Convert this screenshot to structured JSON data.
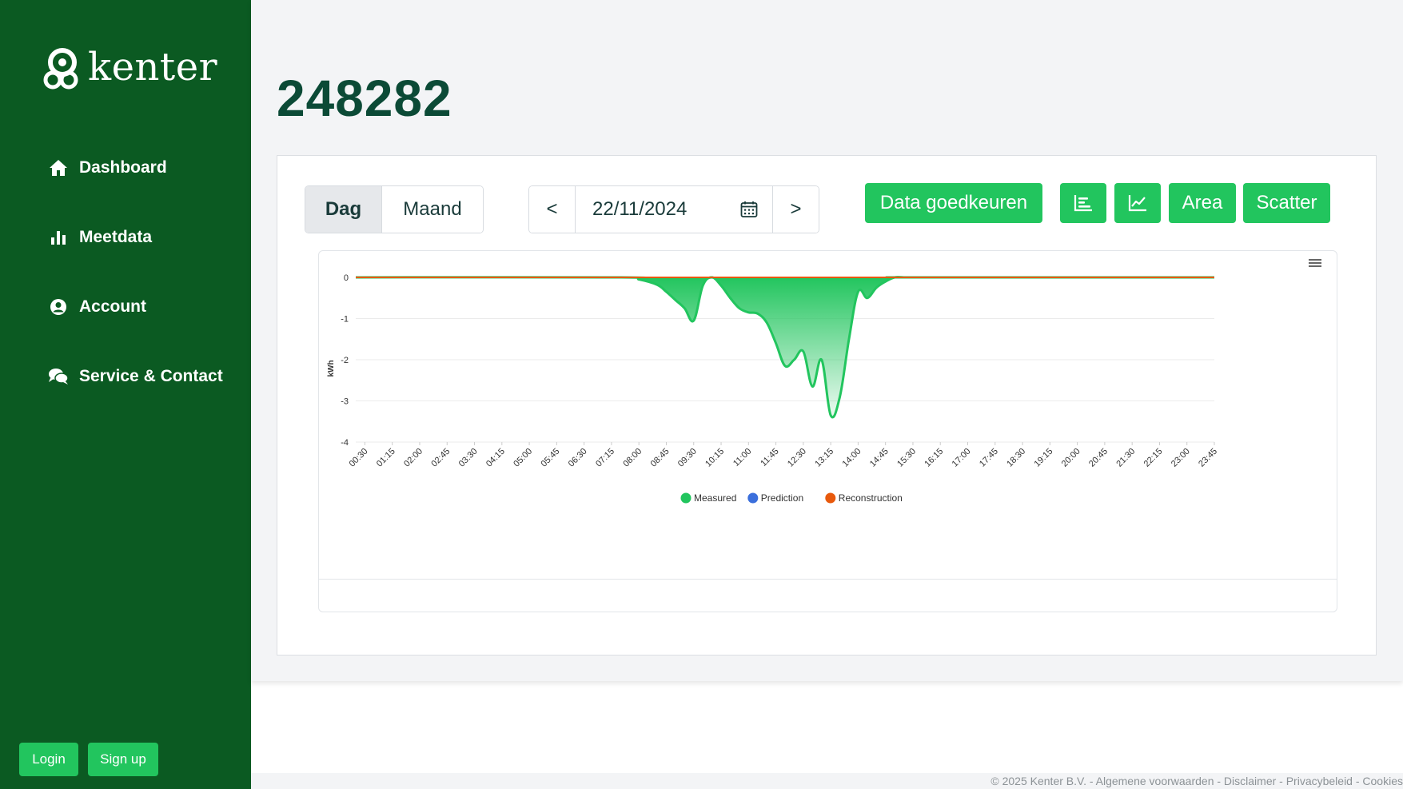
{
  "sidebar": {
    "logo_text": "kenter",
    "nav": [
      {
        "label": "Dashboard",
        "icon": "home-icon"
      },
      {
        "label": "Meetdata",
        "icon": "bar-chart-icon"
      },
      {
        "label": "Account",
        "icon": "user-circle-icon"
      },
      {
        "label": "Service & Contact",
        "icon": "chat-icon"
      }
    ],
    "login_label": "Login",
    "signup_label": "Sign up"
  },
  "main": {
    "title": "248282",
    "period": {
      "day_label": "Dag",
      "month_label": "Maand",
      "selected": "Dag"
    },
    "date_nav": {
      "prev_label": "<",
      "date_value": "22/11/2024",
      "next_label": ">"
    },
    "actions": {
      "approve_label": "Data goedkeuren",
      "area_label": "Area",
      "scatter_label": "Scatter"
    }
  },
  "chart_data": {
    "type": "area",
    "ylabel": "kWh",
    "ylim": [
      -4,
      0
    ],
    "yticks": [
      0,
      -1,
      -2,
      -3,
      -4
    ],
    "x_tick_labels": [
      "00:30",
      "01:15",
      "02:00",
      "02:45",
      "03:30",
      "04:15",
      "05:00",
      "05:45",
      "06:30",
      "07:15",
      "08:00",
      "08:45",
      "09:30",
      "10:15",
      "11:00",
      "11:45",
      "12:30",
      "13:15",
      "14:00",
      "14:45",
      "15:30",
      "16:15",
      "17:00",
      "17:45",
      "18:30",
      "19:15",
      "20:00",
      "20:45",
      "21:30",
      "22:15",
      "23:00",
      "23:45"
    ],
    "x": [
      "00:15",
      "07:30",
      "08:00",
      "08:30",
      "08:45",
      "09:00",
      "09:15",
      "09:30",
      "09:45",
      "10:00",
      "10:15",
      "10:30",
      "10:45",
      "11:00",
      "11:15",
      "11:30",
      "11:45",
      "12:00",
      "12:15",
      "12:30",
      "12:45",
      "13:00",
      "13:15",
      "13:30",
      "13:45",
      "14:00",
      "14:15",
      "14:30",
      "14:45",
      "15:00",
      "15:15",
      "15:30",
      "23:45"
    ],
    "series": [
      {
        "name": "Measured",
        "color": "#22c55e",
        "values": [
          0,
          0,
          -0.05,
          -0.18,
          -0.35,
          -0.55,
          -0.75,
          -1.05,
          -0.2,
          0,
          -0.2,
          -0.5,
          -0.75,
          -0.85,
          -0.88,
          -1.1,
          -1.6,
          -2.15,
          -2.0,
          -1.8,
          -2.65,
          -2.0,
          -3.35,
          -2.9,
          -1.5,
          -0.35,
          -0.5,
          -0.25,
          -0.1,
          0,
          0,
          0,
          0
        ]
      },
      {
        "name": "Prediction",
        "color": "#3b6fdc",
        "values": []
      },
      {
        "name": "Reconstruction",
        "color": "#e8590c",
        "values": [
          0,
          0
        ]
      }
    ],
    "legend_position": "bottom"
  },
  "footer": {
    "text": "© 2025 Kenter B.V. - Algemene voorwaarden - Disclaimer - Privacybeleid - Cookies"
  }
}
